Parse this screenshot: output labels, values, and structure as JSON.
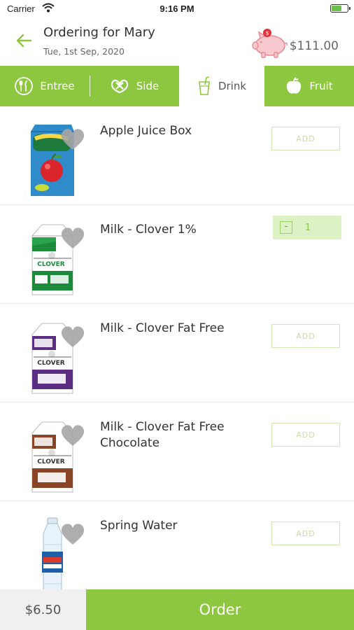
{
  "status": {
    "carrier": "Carrier",
    "time": "9:16 PM"
  },
  "header": {
    "title": "Ordering for Mary",
    "date": "Tue, 1st Sep, 2020",
    "balance": "$111.00",
    "piggy_badge": "$"
  },
  "tabs": [
    {
      "label": "Entree",
      "icon": "utensils-icon",
      "active": false
    },
    {
      "label": "Side",
      "icon": "pretzel-icon",
      "active": false
    },
    {
      "label": "Drink",
      "icon": "cup-straw-icon",
      "active": true
    },
    {
      "label": "Fruit",
      "icon": "apple-icon",
      "active": false
    }
  ],
  "items": [
    {
      "name": "Apple Juice Box",
      "action": "ADD",
      "image": "juice-box-image"
    },
    {
      "name": "Milk - Clover 1%",
      "quantity": "1",
      "minus": "-",
      "image": "milk-carton-green-image"
    },
    {
      "name": "Milk - Clover Fat Free",
      "action": "ADD",
      "image": "milk-carton-purple-image"
    },
    {
      "name": "Milk - Clover Fat Free Chocolate",
      "action": "ADD",
      "image": "milk-carton-brown-image"
    },
    {
      "name": "Spring Water",
      "action": "ADD",
      "image": "water-bottle-image"
    }
  ],
  "footer": {
    "total": "$6.50",
    "order_label": "Order"
  },
  "colors": {
    "brand_green": "#8dc63f",
    "piggy_pink": "#f2a0a8"
  }
}
